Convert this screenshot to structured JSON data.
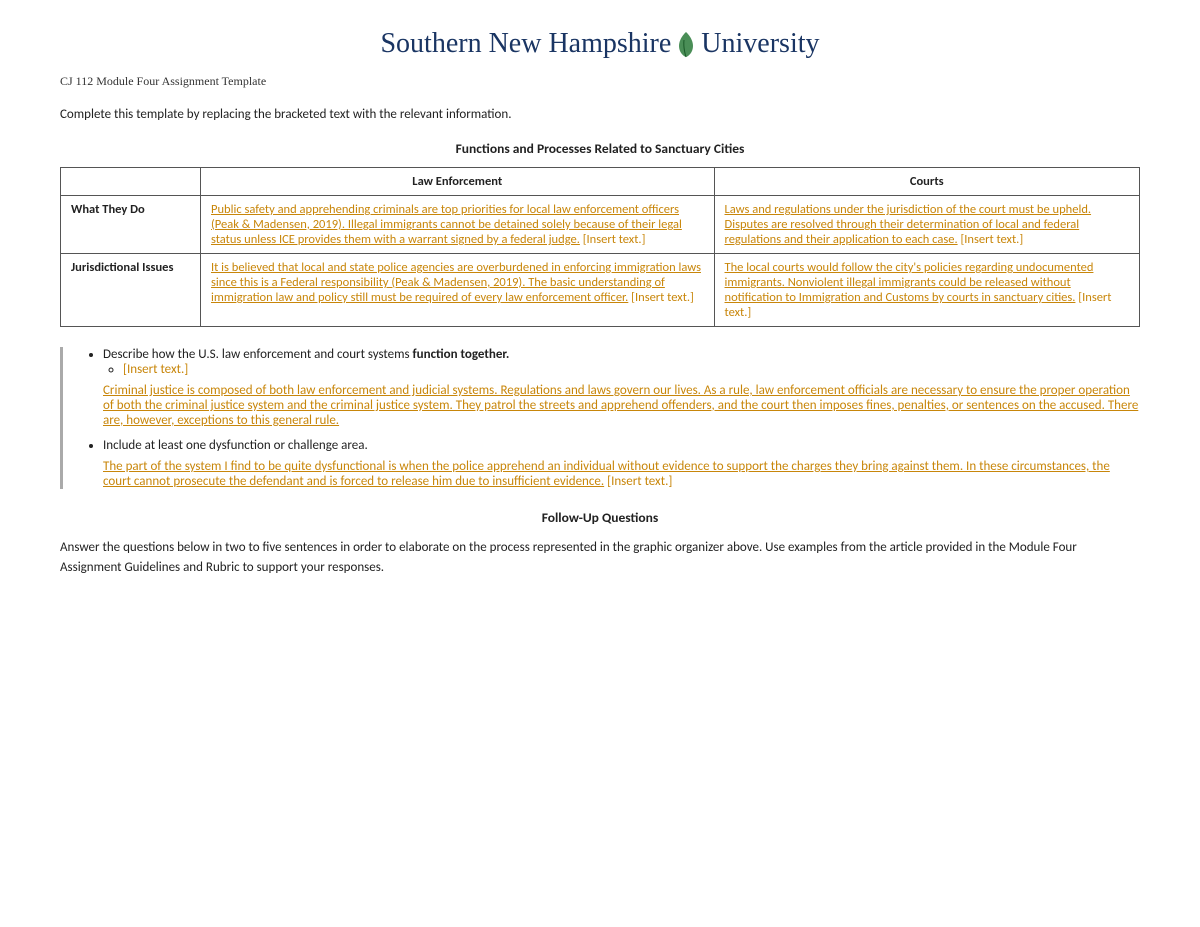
{
  "header": {
    "logo_text": "Southern New Hampshire University",
    "assignment_title": "CJ 112 Module Four Assignment Template"
  },
  "instructions": "Complete this template by replacing the bracketed text with the relevant information.",
  "table_section": {
    "heading": "Functions and Processes Related to Sanctuary Cities",
    "col_empty": "",
    "col_law": "Law Enforcement",
    "col_courts": "Courts",
    "rows": [
      {
        "label": "What They Do",
        "law_text": "Public safety and apprehending criminals are top priorities for local law enforcement officers (Peak & Madensen, 2019). Illegal immigrants cannot be detained solely because of their legal status unless ICE provides them with a warrant signed by a federal judge.",
        "law_bracket": "[Insert text.]",
        "courts_text": "Laws and regulations under the jurisdiction of the court must be upheld. Disputes are resolved through their determination of local and federal regulations and their application to each case.",
        "courts_bracket": "[Insert text.]"
      },
      {
        "label": "Jurisdictional Issues",
        "law_text": "It is believed that local and state police agencies are overburdened in enforcing immigration laws since this is a Federal responsibility (Peak & Madensen, 2019). The basic understanding of immigration law and policy still must be required of every law enforcement officer.",
        "law_bracket": "[Insert text.]",
        "courts_text": "The local courts would follow the city's policies regarding undocumented immigrants. Nonviolent illegal immigrants could be released without notification to Immigration and Customs by courts in sanctuary cities.",
        "courts_bracket": "[Insert text.]"
      }
    ]
  },
  "bullet_section": {
    "item1_label": "Describe how the U.S. law enforcement and court systems ",
    "item1_bold": "function together.",
    "item1_sub_bracket": "[Insert text.]",
    "item1_body": "Criminal justice is composed of both law enforcement and judicial systems. Regulations and laws govern our lives. As a rule, law enforcement officials are necessary to ensure the proper operation of both the criminal justice system and the criminal justice system. They patrol the streets and apprehend offenders, and the court then imposes fines, penalties, or sentences on the accused. There are, however, exceptions to this general rule.",
    "item2_label": "Include at least one dysfunction or challenge area.",
    "item2_body": "The part of the system I find to be quite dysfunctional is when the police apprehend an individual without evidence to support the charges they bring against them. In these circumstances, the court cannot prosecute the defendant and is forced to release him due to insufficient evidence.",
    "item2_bracket": "[Insert text.]"
  },
  "follow_up": {
    "heading": "Follow-Up Questions",
    "body": "Answer the questions below in two to five sentences in order to elaborate on the process represented in the graphic organizer above. Use examples from the article provided in the Module Four Assignment Guidelines and Rubric to support your responses."
  }
}
